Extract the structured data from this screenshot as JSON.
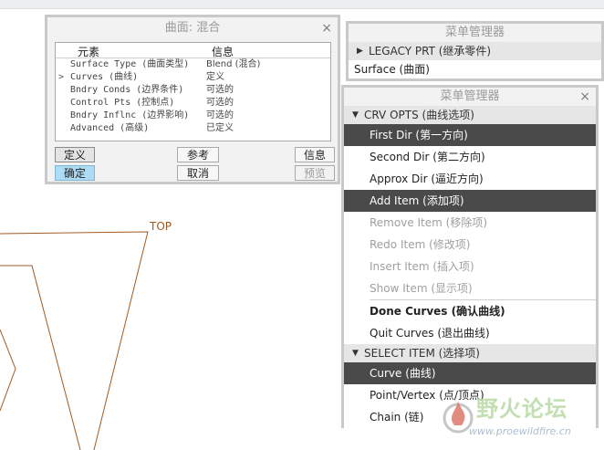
{
  "element_dialog": {
    "title": "曲面: 混合",
    "close_glyph": "×",
    "header_element": "元素",
    "header_info": "信息",
    "rows": [
      {
        "element": "Surface Type (曲面类型)",
        "info": "Blend (混合)",
        "current": false
      },
      {
        "element": "Curves (曲线)",
        "info": "定义",
        "current": true
      },
      {
        "element": "Bndry Conds (边界条件)",
        "info": "可选的",
        "current": false
      },
      {
        "element": "Control Pts (控制点)",
        "info": "可选的",
        "current": false
      },
      {
        "element": "Bndry Inflnc (边界影响)",
        "info": "可选的",
        "current": false
      },
      {
        "element": "Advanced (高级)",
        "info": "已定义",
        "current": false
      }
    ],
    "current_arrow": ">",
    "buttons": {
      "define": "定义",
      "reference": "参考",
      "info": "信息",
      "ok": "确定",
      "cancel": "取消",
      "preview": "预览"
    }
  },
  "menu_manager_1": {
    "title": "菜单管理器",
    "section": "LEGACY PRT (继承零件)",
    "section_glyph": "▶",
    "items": [
      "Surface (曲面)"
    ]
  },
  "menu_manager_2": {
    "title": "菜单管理器",
    "close_glyph": "×",
    "crv_opts": {
      "label": "CRV OPTS (曲线选项)",
      "glyph": "▼",
      "items": [
        {
          "label": "First Dir (第一方向)",
          "state": "highlighted"
        },
        {
          "label": "Second Dir (第二方向)",
          "state": "normal"
        },
        {
          "label": "Approx Dir (逼近方向)",
          "state": "normal"
        },
        {
          "label": "Add Item (添加项)",
          "state": "highlighted"
        },
        {
          "label": "Remove Item (移除项)",
          "state": "disabled"
        },
        {
          "label": "Redo Item (修改项)",
          "state": "disabled"
        },
        {
          "label": "Insert Item (插入项)",
          "state": "disabled"
        },
        {
          "label": "Show Item (显示项)",
          "state": "disabled"
        },
        {
          "label": "Done Curves (确认曲线)",
          "state": "bold"
        },
        {
          "label": "Quit Curves (退出曲线)",
          "state": "normal"
        }
      ]
    },
    "select_item": {
      "label": "SELECT ITEM (选择项)",
      "glyph": "▼",
      "items": [
        {
          "label": "Curve (曲线)",
          "state": "highlighted"
        },
        {
          "label": "Point/Vertex (点/顶点)",
          "state": "normal"
        },
        {
          "label": "Chain (链)",
          "state": "normal"
        }
      ]
    }
  },
  "model": {
    "datum_label": "TOP",
    "curve_color": "#a05a24"
  },
  "watermark": {
    "title": "野火论坛",
    "url": "www.proewildfire.cn"
  }
}
